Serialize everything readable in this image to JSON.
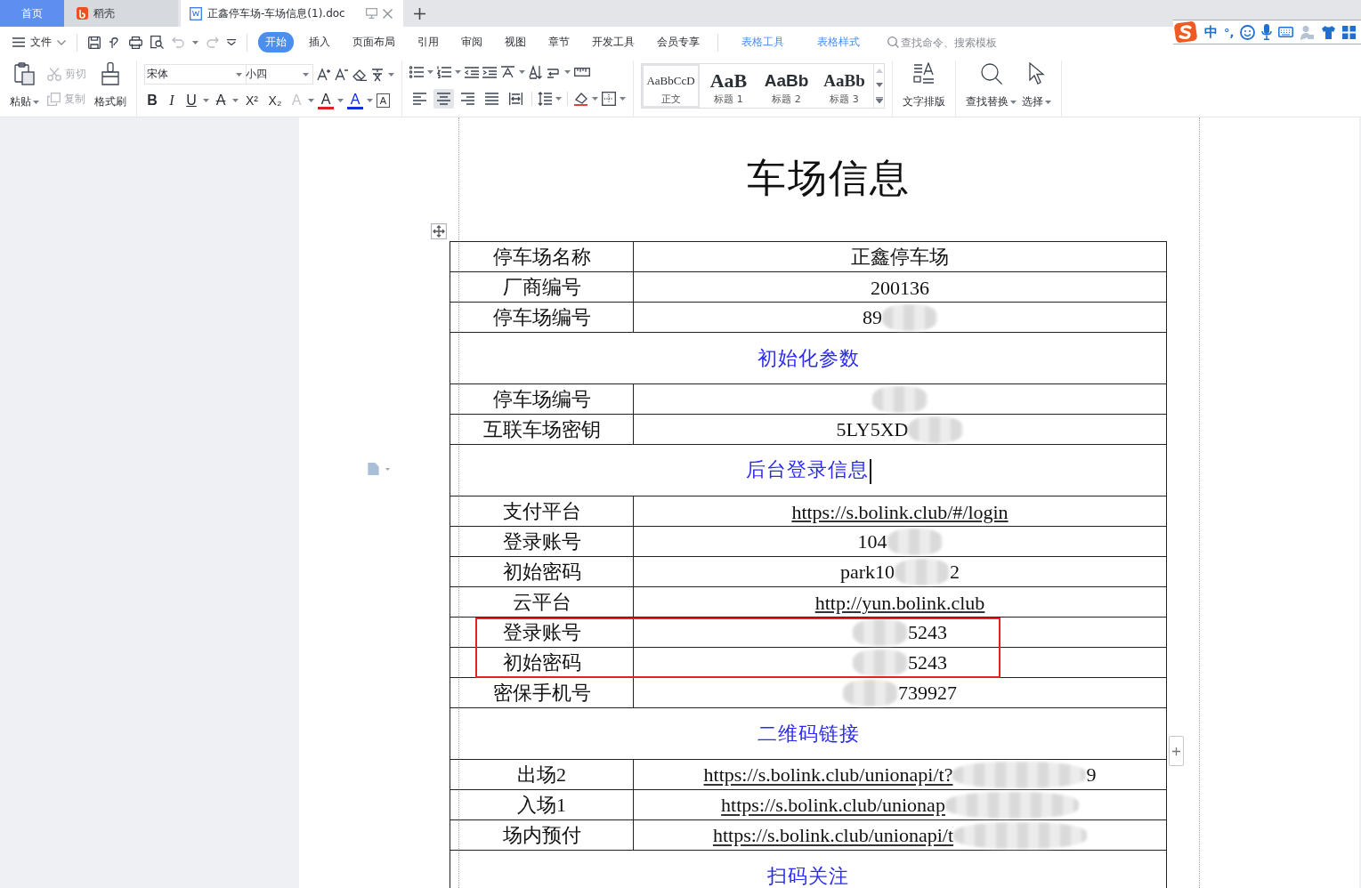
{
  "tabs": [
    {
      "label": "首页",
      "kind": "home",
      "selected": false
    },
    {
      "label": "稻壳",
      "kind": "app",
      "selected": false
    },
    {
      "label": "正鑫停车场-车场信息(1).doc",
      "kind": "doc",
      "selected": true
    }
  ],
  "menu": {
    "file": "文件",
    "tabs": [
      {
        "label": "开始",
        "selected": true
      },
      {
        "label": "插入",
        "selected": false
      },
      {
        "label": "页面布局",
        "selected": false
      },
      {
        "label": "引用",
        "selected": false
      },
      {
        "label": "审阅",
        "selected": false
      },
      {
        "label": "视图",
        "selected": false
      },
      {
        "label": "章节",
        "selected": false
      },
      {
        "label": "开发工具",
        "selected": false
      },
      {
        "label": "会员专享",
        "selected": false
      }
    ],
    "context_tabs": [
      "表格工具",
      "表格样式"
    ],
    "search": {
      "placeholder": "查找命令、搜索模板"
    }
  },
  "ime": {
    "mode": "中",
    "punctuation": "°,"
  },
  "ribbon": {
    "paste": "粘贴",
    "clipboard": [
      {
        "label": "剪切",
        "kind": "cut",
        "disabled": true
      },
      {
        "label": "复制",
        "kind": "copy",
        "disabled": true
      }
    ],
    "format_painter": "格式刷",
    "font": {
      "name": "宋体",
      "size": "小四"
    },
    "format_buttons": [
      {
        "glyph": "B",
        "kind": "bold"
      },
      {
        "glyph": "I",
        "kind": "italic"
      },
      {
        "glyph": "U",
        "kind": "underline"
      },
      {
        "glyph": "A",
        "kind": "strike"
      },
      {
        "glyph": "X²",
        "kind": "sup"
      },
      {
        "glyph": "X₂",
        "kind": "sub"
      },
      {
        "glyph": "A",
        "kind": "effect"
      },
      {
        "glyph": "A",
        "kind": "highlight"
      },
      {
        "glyph": "A",
        "kind": "color"
      },
      {
        "glyph": "A",
        "kind": "border"
      }
    ],
    "align": [
      {
        "kind": "left",
        "selected": false
      },
      {
        "kind": "center",
        "selected": true
      },
      {
        "kind": "right",
        "selected": false
      },
      {
        "kind": "justify",
        "selected": false
      },
      {
        "kind": "distribute",
        "selected": false
      }
    ],
    "styles": [
      {
        "preview": "AaBbCcD",
        "label": "正文",
        "kind": "body",
        "selected": true
      },
      {
        "preview": "AaB",
        "label": "标题 1",
        "kind": "h1",
        "selected": false
      },
      {
        "preview": "AaBb",
        "label": "标题 2",
        "kind": "h2",
        "selected": false
      },
      {
        "preview": "AaBb",
        "label": "标题 3",
        "kind": "h3",
        "selected": false
      }
    ],
    "text_layout": "文字排版",
    "find_replace": "查找替换",
    "select": "选择"
  },
  "document": {
    "title": "车场信息",
    "rows": [
      {
        "kind": "field",
        "label": "停车场名称",
        "value": [
          {
            "kind": "text",
            "text": "正鑫停车场"
          }
        ],
        "highlighted": false
      },
      {
        "kind": "field",
        "label": "厂商编号",
        "value": [
          {
            "kind": "text",
            "text": "200136"
          }
        ],
        "highlighted": false
      },
      {
        "kind": "field",
        "label": "停车场编号",
        "value": [
          {
            "kind": "text",
            "text": "89"
          },
          {
            "kind": "redacted"
          }
        ],
        "highlighted": false
      },
      {
        "kind": "section",
        "label": "初始化参数",
        "cursor": false
      },
      {
        "kind": "field",
        "label": "停车场编号",
        "value": [
          {
            "kind": "redacted"
          }
        ],
        "highlighted": false
      },
      {
        "kind": "field",
        "label": "互联车场密钥",
        "value": [
          {
            "kind": "text",
            "text": "5LY5XD"
          },
          {
            "kind": "redacted"
          }
        ],
        "highlighted": false
      },
      {
        "kind": "section",
        "label": "后台登录信息",
        "cursor": true
      },
      {
        "kind": "field",
        "label": "支付平台",
        "value": [
          {
            "kind": "link",
            "text": "https://s.bolink.club/#/login"
          }
        ],
        "highlighted": false
      },
      {
        "kind": "field",
        "label": "登录账号",
        "value": [
          {
            "kind": "text",
            "text": "104"
          },
          {
            "kind": "redacted"
          }
        ],
        "highlighted": false
      },
      {
        "kind": "field",
        "label": "初始密码",
        "value": [
          {
            "kind": "text",
            "text": "park10"
          },
          {
            "kind": "redacted"
          },
          {
            "kind": "text",
            "text": "2"
          }
        ],
        "highlighted": false
      },
      {
        "kind": "field",
        "label": "云平台",
        "value": [
          {
            "kind": "link",
            "text": "http://yun.bolink.club"
          }
        ],
        "highlighted": false
      },
      {
        "kind": "field",
        "label": "登录账号",
        "value": [
          {
            "kind": "redacted"
          },
          {
            "kind": "text",
            "text": "5243"
          }
        ],
        "highlighted": true
      },
      {
        "kind": "field",
        "label": "初始密码",
        "value": [
          {
            "kind": "redacted"
          },
          {
            "kind": "text",
            "text": "5243"
          }
        ],
        "highlighted": true
      },
      {
        "kind": "field",
        "label": "密保手机号",
        "value": [
          {
            "kind": "redacted"
          },
          {
            "kind": "text",
            "text": "739927"
          }
        ],
        "highlighted": false
      },
      {
        "kind": "section",
        "label": "二维码链接",
        "cursor": false
      },
      {
        "kind": "field",
        "label": "出场2",
        "value": [
          {
            "kind": "link",
            "text": "https://s.bolink.club/unionapi/t?"
          },
          {
            "kind": "redacted"
          },
          {
            "kind": "text",
            "text": "9"
          }
        ],
        "highlighted": false
      },
      {
        "kind": "field",
        "label": "入场1",
        "value": [
          {
            "kind": "link",
            "text": "https://s.bolink.club/unionap"
          },
          {
            "kind": "redacted"
          }
        ],
        "highlighted": false
      },
      {
        "kind": "field",
        "label": "场内预付",
        "value": [
          {
            "kind": "link",
            "text": "https://s.bolink.club/unionapi/t"
          },
          {
            "kind": "redacted"
          }
        ],
        "highlighted": false
      },
      {
        "kind": "section",
        "label": "扫码关注",
        "cursor": false
      }
    ]
  }
}
